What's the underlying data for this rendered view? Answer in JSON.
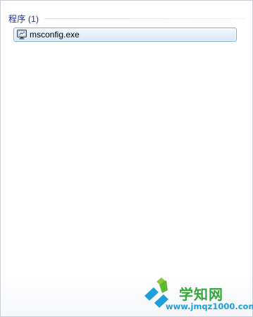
{
  "results_group": {
    "title": "程序 (1)",
    "items": [
      {
        "label": "msconfig.exe",
        "icon": "monitor-config-icon"
      }
    ]
  },
  "watermark": {
    "title": "学知网",
    "url": "www.jmqz1000.com"
  },
  "colors": {
    "group_title": "#1e3287",
    "selection_border": "#84acdd",
    "selection_fill": "#e3effc",
    "watermark_green": "#35a73a",
    "watermark_blue": "#1e9fd8"
  }
}
